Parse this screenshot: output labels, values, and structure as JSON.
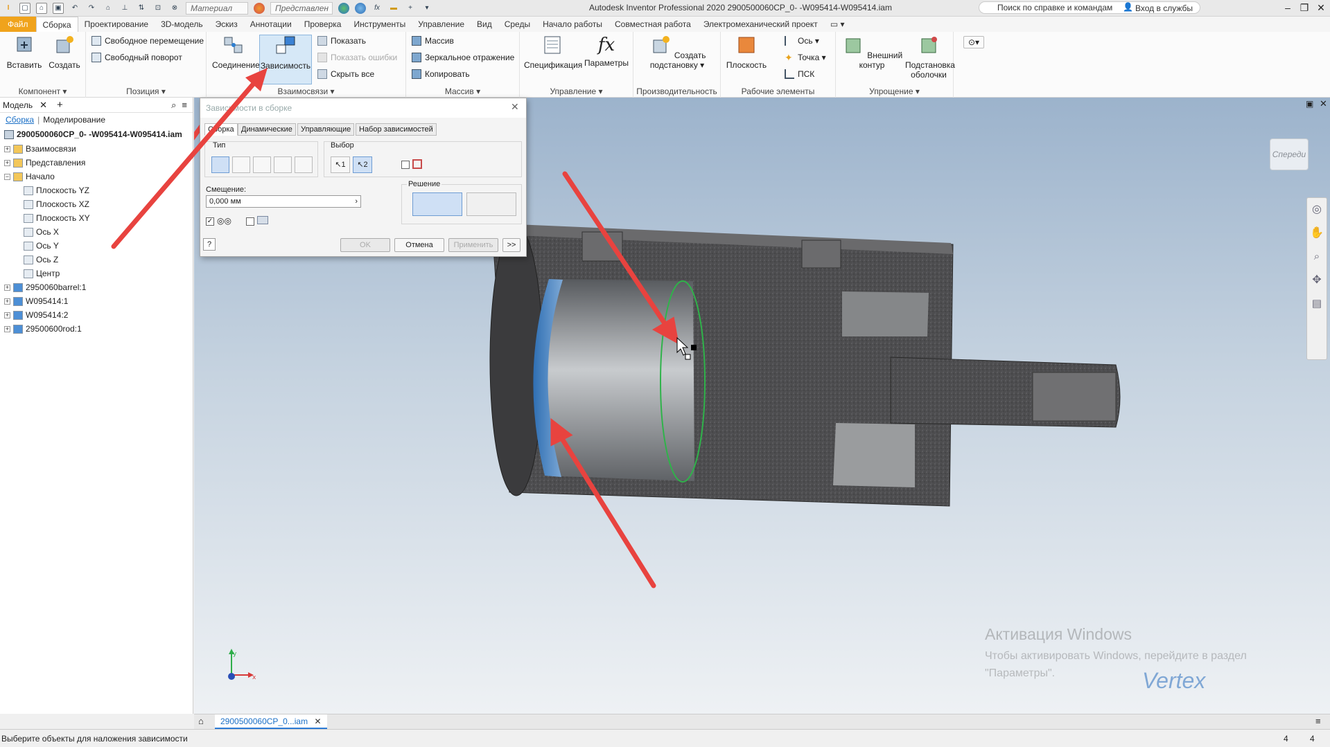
{
  "app_title": "Autodesk Inventor Professional 2020   2900500060CP_0- -W095414-W095414.iam",
  "quick_access": {
    "material_combo": "Материал",
    "appearance_combo": "Представлен"
  },
  "help_search": "Поиск по справке и командам",
  "sign_in": "Вход в службы",
  "menu": [
    {
      "label": "Файл"
    },
    {
      "label": "Сборка"
    },
    {
      "label": "Проектирование"
    },
    {
      "label": "3D-модель"
    },
    {
      "label": "Эскиз"
    },
    {
      "label": "Аннотации"
    },
    {
      "label": "Проверка"
    },
    {
      "label": "Инструменты"
    },
    {
      "label": "Управление"
    },
    {
      "label": "Вид"
    },
    {
      "label": "Среды"
    },
    {
      "label": "Начало работы"
    },
    {
      "label": "Совместная работа"
    },
    {
      "label": "Электромеханический проект"
    }
  ],
  "ribbon": {
    "component": {
      "label": "Компонент",
      "insert": "Вставить",
      "create": "Создать"
    },
    "position": {
      "label": "Позиция",
      "free_move": "Свободное перемещение",
      "free_rotate": "Свободный поворот"
    },
    "relationships": {
      "label": "Взаимосвязи",
      "joint": "Соединение",
      "constrain": "Зависимость",
      "show": "Показать",
      "show_errors": "Показать ошибки",
      "hide_all": "Скрыть все"
    },
    "pattern": {
      "label": "Массив",
      "pattern": "Массив",
      "mirror": "Зеркальное отражение",
      "copy": "Копировать"
    },
    "manage": {
      "label": "Управление",
      "bom": "Спецификация",
      "params": "Параметры"
    },
    "productivity": {
      "label": "Производительность",
      "create_sub_line1": "Создать",
      "create_sub_line2": "подстановку"
    },
    "work_features": {
      "label": "Рабочие элементы",
      "plane": "Плоскость",
      "axis": "Ось",
      "point": "Точка",
      "ucs": "ПСК"
    },
    "simplification": {
      "label": "Упрощение",
      "shrinkwrap": "Внешний контур",
      "substitute_line1": "Подстановка",
      "substitute_line2": "оболочки"
    }
  },
  "browser": {
    "tab_model": "Модель",
    "sub_assembly": "Сборка",
    "sub_modeling": "Моделирование",
    "root": "2900500060CP_0- -W095414-W095414.iam",
    "items": [
      {
        "label": "Взаимосвязи",
        "depth": 1
      },
      {
        "label": "Представления",
        "depth": 1
      },
      {
        "label": "Начало",
        "depth": 1
      },
      {
        "label": "Плоскость YZ",
        "depth": 2
      },
      {
        "label": "Плоскость XZ",
        "depth": 2
      },
      {
        "label": "Плоскость XY",
        "depth": 2
      },
      {
        "label": "Ось X",
        "depth": 2
      },
      {
        "label": "Ось Y",
        "depth": 2
      },
      {
        "label": "Ось Z",
        "depth": 2
      },
      {
        "label": "Центр",
        "depth": 2
      },
      {
        "label": "2950060barrel:1",
        "depth": 1
      },
      {
        "label": "W095414:1",
        "depth": 1
      },
      {
        "label": "W095414:2",
        "depth": 1
      },
      {
        "label": "29500600rod:1",
        "depth": 1
      }
    ]
  },
  "dialog": {
    "title": "Зависимости в сборке",
    "tabs": [
      "Сборка",
      "Динамические",
      "Управляющие",
      "Набор зависимостей"
    ],
    "type_label": "Тип",
    "selection_label": "Выбор",
    "offset_label": "Смещение:",
    "offset_value": "0,000 мм",
    "solution_label": "Решение",
    "ok": "OK",
    "cancel": "Отмена",
    "apply": "Применить",
    "more": ">>",
    "help": "?"
  },
  "viewcube_label": "Спереди",
  "doc_tab": "2900500060CP_0...iam",
  "status": {
    "message": "Выберите объекты для наложения зависимости",
    "count1": "4",
    "count2": "4"
  },
  "watermark": {
    "title": "Активация Windows",
    "text": "Чтобы активировать Windows, перейдите в раздел \"Параметры\"."
  },
  "brand": "Vertex",
  "colors": {
    "file_tab": "#f0a31c",
    "arrow": "#e8433f",
    "selection": "#2fb34a"
  }
}
